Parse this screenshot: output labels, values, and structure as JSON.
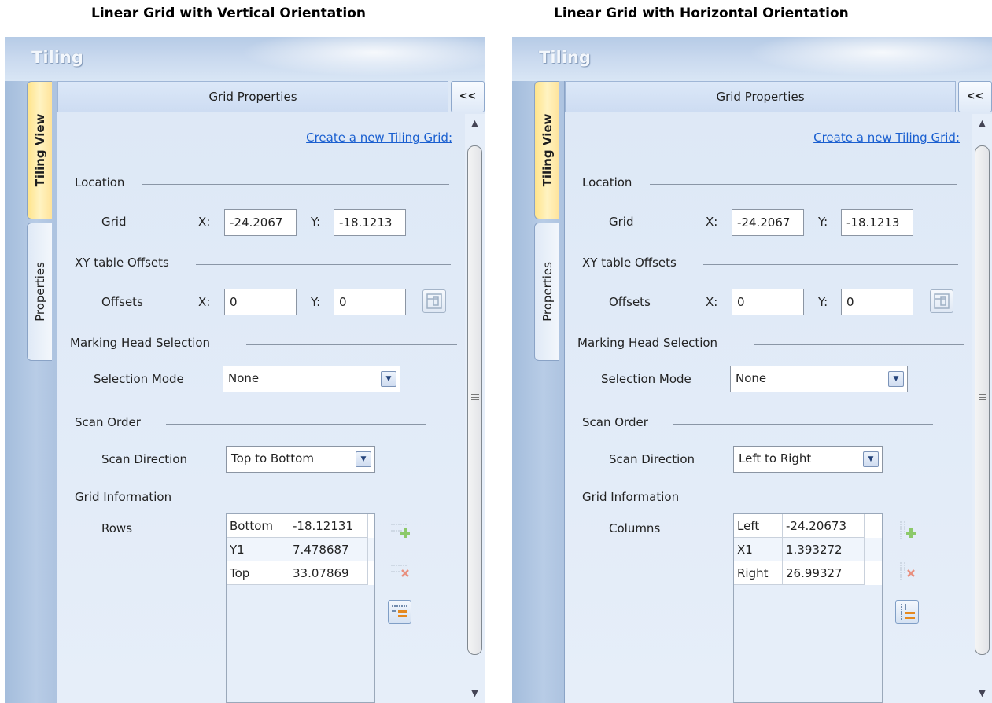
{
  "captions": {
    "left": "Linear Grid with Vertical Orientation",
    "right": "Linear Grid with Horizontal Orientation"
  },
  "panels": [
    {
      "app_title": "Tiling",
      "tabs": {
        "active": "Tiling View",
        "inactive": "Properties"
      },
      "header_title": "Grid Properties",
      "collapse_label": "<<",
      "create_link": "Create a new Tiling Grid:",
      "location": {
        "section": "Location",
        "row_label": "Grid",
        "x_label": "X:",
        "x_value": "-24.2067",
        "y_label": "Y:",
        "y_value": "-18.1213"
      },
      "offsets": {
        "section": "XY table Offsets",
        "row_label": "Offsets",
        "x_label": "X:",
        "x_value": "0",
        "y_label": "Y:",
        "y_value": "0"
      },
      "marking_head": {
        "section": "Marking Head Selection",
        "mode_label": "Selection Mode",
        "mode_value": "None"
      },
      "scan_order": {
        "section": "Scan Order",
        "direction_label": "Scan Direction",
        "direction_value": "Top to Bottom"
      },
      "grid_info": {
        "section": "Grid Information",
        "list_label": "Rows",
        "rows": [
          {
            "name": "Bottom",
            "value": "-18.12131"
          },
          {
            "name": "Y1",
            "value": "7.478687"
          },
          {
            "name": "Top",
            "value": "33.07869"
          }
        ],
        "orientation": "vertical"
      }
    },
    {
      "app_title": "Tiling",
      "tabs": {
        "active": "Tiling View",
        "inactive": "Properties"
      },
      "header_title": "Grid Properties",
      "collapse_label": "<<",
      "create_link": "Create a new Tiling Grid:",
      "location": {
        "section": "Location",
        "row_label": "Grid",
        "x_label": "X:",
        "x_value": "-24.2067",
        "y_label": "Y:",
        "y_value": "-18.1213"
      },
      "offsets": {
        "section": "XY table Offsets",
        "row_label": "Offsets",
        "x_label": "X:",
        "x_value": "0",
        "y_label": "Y:",
        "y_value": "0"
      },
      "marking_head": {
        "section": "Marking Head Selection",
        "mode_label": "Selection Mode",
        "mode_value": "None"
      },
      "scan_order": {
        "section": "Scan Order",
        "direction_label": "Scan Direction",
        "direction_value": "Left to Right"
      },
      "grid_info": {
        "section": "Grid Information",
        "list_label": "Columns",
        "rows": [
          {
            "name": "Left",
            "value": "-24.20673"
          },
          {
            "name": "X1",
            "value": "1.393272"
          },
          {
            "name": "Right",
            "value": "26.99327"
          }
        ],
        "orientation": "horizontal"
      }
    }
  ]
}
